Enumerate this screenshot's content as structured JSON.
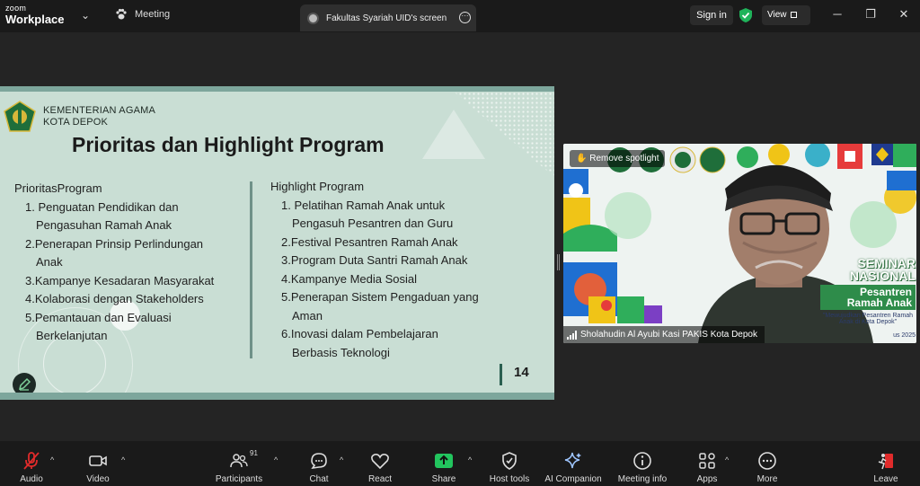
{
  "titlebar": {
    "logo_line1": "zoom",
    "logo_line2": "Workplace",
    "meeting_tab": "Meeting",
    "share_tab": "Fakultas Syariah UID's screen",
    "sign_in": "Sign in",
    "view": "View",
    "minimize": "─",
    "restore": "❐",
    "close": "✕"
  },
  "slide": {
    "ministry_line1": "KEMENTERIAN AGAMA",
    "ministry_line2": "KOTA DEPOK",
    "title": "Prioritas dan Highlight Program",
    "left_heading": "PrioritasProgram",
    "left_lines": [
      "1. Penguatan Pendidikan dan",
      "Pengasuhan Ramah Anak",
      "2.Penerapan Prinsip Perlindungan",
      "Anak",
      "3.Kampanye Kesadaran Masyarakat",
      "4.Kolaborasi dengan Stakeholders",
      "5.Pemantauan dan Evaluasi",
      "Berkelanjutan"
    ],
    "right_heading": "Highlight Program",
    "right_lines": [
      "1. Pelatihan Ramah Anak untuk",
      "Pengasuh Pesantren dan Guru",
      "2.Festival Pesantren Ramah Anak",
      "3.Program Duta Santri Ramah Anak",
      "4.Kampanye Media Sosial",
      "5.Penerapan Sistem Pengaduan yang",
      "Aman",
      "6.Inovasi dalam Pembelajaran",
      "Berbasis Teknologi"
    ],
    "page_number": "14"
  },
  "video": {
    "spotlight_label": "Remove spotlight",
    "participant_name": "Sholahudin Al Ayubi Kasi PAKIS Kota Depok",
    "banner_line1": "SEMINAR",
    "banner_line2": "NASIONAL",
    "banner_line3": "Pesantren Ramah Anak",
    "banner_line4": "\"Mewujudkan Pesantren Ramah Anak di Kota Depok\"",
    "banner_line5": "us 2025"
  },
  "toolbar": {
    "audio": "Audio",
    "video": "Video",
    "participants": "Participants",
    "participants_count": "91",
    "chat": "Chat",
    "react": "React",
    "share": "Share",
    "host_tools": "Host tools",
    "ai_companion": "AI Companion",
    "meeting_info": "Meeting info",
    "apps": "Apps",
    "more": "More",
    "leave": "Leave"
  },
  "colors": {
    "share_green": "#22c55e",
    "mic_muted": "#e02b2b",
    "leave_red": "#e02b2b",
    "shield_green": "#1fb35a",
    "slide_bg": "#c9ded4"
  }
}
